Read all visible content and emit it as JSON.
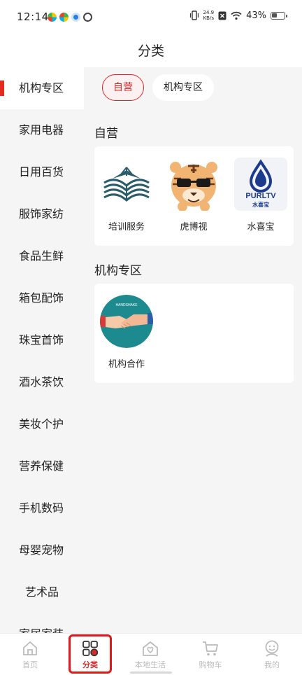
{
  "status_bar": {
    "time": "12:14",
    "net_speed_value": "24.9",
    "net_speed_unit": "KB/s",
    "battery": "43%"
  },
  "header": {
    "title": "分类"
  },
  "sidebar": {
    "items": [
      {
        "label": "机构专区"
      },
      {
        "label": "家用电器"
      },
      {
        "label": "日用百货"
      },
      {
        "label": "服饰家纺"
      },
      {
        "label": "食品生鲜"
      },
      {
        "label": "箱包配饰"
      },
      {
        "label": "珠宝首饰"
      },
      {
        "label": "酒水茶饮"
      },
      {
        "label": "美妆个护"
      },
      {
        "label": "营养保健"
      },
      {
        "label": "手机数码"
      },
      {
        "label": "母婴宠物"
      },
      {
        "label": "艺术品"
      },
      {
        "label": "家居家装"
      }
    ]
  },
  "main": {
    "tabs": [
      {
        "label": "自营"
      },
      {
        "label": "机构专区"
      }
    ],
    "sections": [
      {
        "title": "自营",
        "items": [
          {
            "label": "培训服务",
            "icon": "book-icon"
          },
          {
            "label": "虎博视",
            "icon": "tiger-icon"
          },
          {
            "label": "水喜宝",
            "icon": "water-drop-logo-icon",
            "logo_text": "PURLTV",
            "logo_subtext": "水喜宝"
          }
        ]
      },
      {
        "title": "机构专区",
        "items": [
          {
            "label": "机构合作",
            "icon": "handshake-icon",
            "logo_text": "HANDSHAKE"
          }
        ]
      }
    ]
  },
  "bottom_nav": {
    "items": [
      {
        "label": "首页",
        "icon": "home-icon"
      },
      {
        "label": "分类",
        "icon": "category-icon"
      },
      {
        "label": "本地生活",
        "icon": "local-life-icon"
      },
      {
        "label": "购物车",
        "icon": "cart-icon"
      },
      {
        "label": "我的",
        "icon": "profile-icon"
      }
    ]
  },
  "colors": {
    "accent": "#d52b2b",
    "sidebar_active_bar": "#e22c1f",
    "background": "#f5f5f5",
    "highlight_box": "#e01818"
  }
}
